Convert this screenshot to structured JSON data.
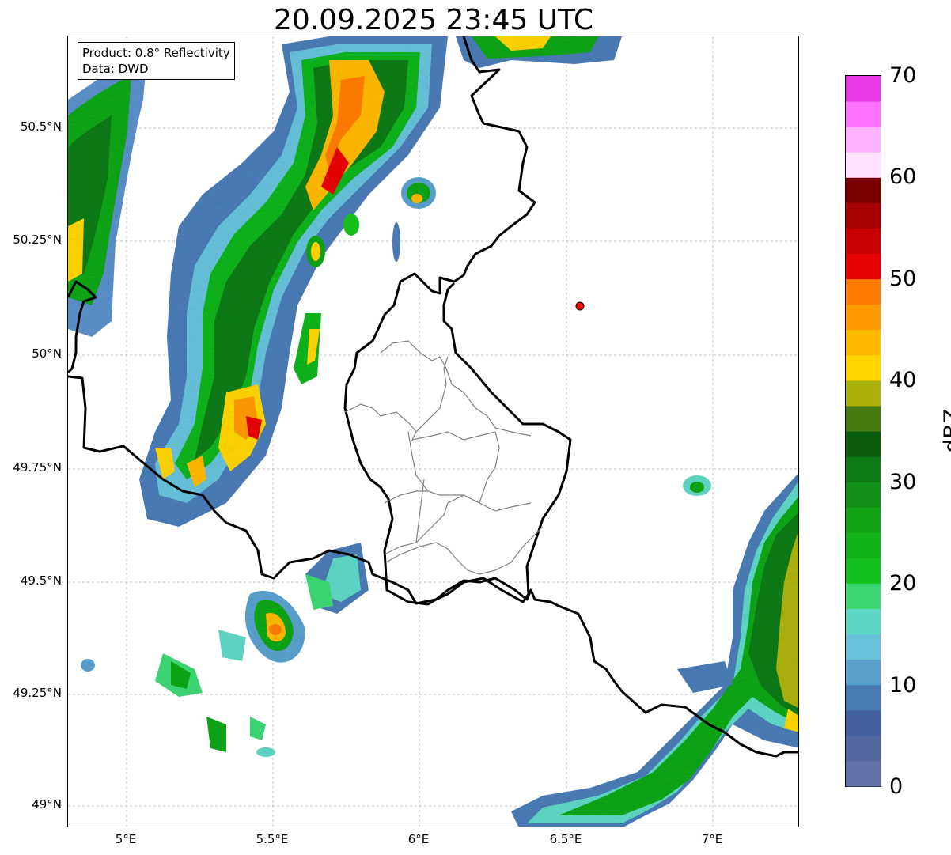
{
  "title": "20.09.2025 23:45 UTC",
  "info": {
    "product": "Product: 0.8° Reflectivity",
    "data": "Data: DWD"
  },
  "map": {
    "lon_range": [
      4.8,
      7.3
    ],
    "lat_range": [
      48.95,
      50.7
    ],
    "y_ticks": [
      "50.5°N",
      "50.25°N",
      "50°N",
      "49.75°N",
      "49.5°N",
      "49.25°N",
      "49°N"
    ],
    "x_ticks": [
      "5°E",
      "5.5°E",
      "6°E",
      "6.5°E",
      "7°E"
    ],
    "marker": {
      "lon": 6.55,
      "lat": 50.11,
      "color": "#ff0000"
    },
    "grid": true
  },
  "colorbar": {
    "label": "dBZ",
    "ticks": [
      "0",
      "10",
      "20",
      "30",
      "40",
      "50",
      "60",
      "70"
    ],
    "range": [
      0,
      70
    ],
    "colors": [
      "#6271a8",
      "#5468a0",
      "#4260a0",
      "#4a7bb5",
      "#5aa0cc",
      "#66c1d9",
      "#5ed6c4",
      "#3dd674",
      "#13c21e",
      "#12b31a",
      "#12a518",
      "#109016",
      "#0e7a13",
      "#0a5c0e",
      "#447a10",
      "#acb10a",
      "#ffd400",
      "#ffb800",
      "#ff9900",
      "#ff7c00",
      "#e60000",
      "#c70000",
      "#a80000",
      "#7d0000",
      "#ffe0ff",
      "#ffb3ff",
      "#ff72ff",
      "#e838e8"
    ]
  }
}
